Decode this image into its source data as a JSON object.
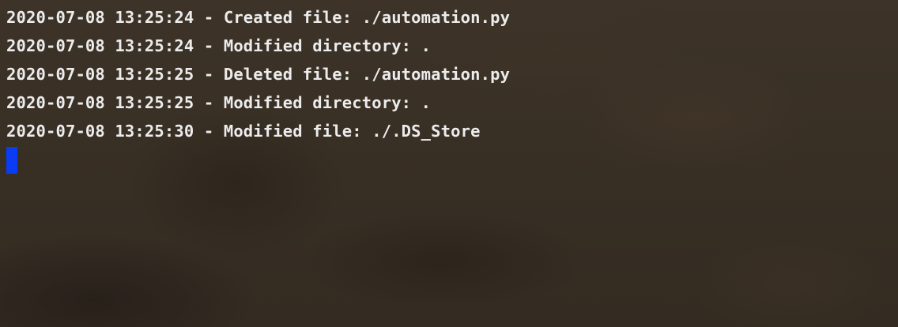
{
  "terminal": {
    "lines": [
      "2020-07-08 13:25:24 - Created file: ./automation.py",
      "2020-07-08 13:25:24 - Modified directory: .",
      "2020-07-08 13:25:25 - Deleted file: ./automation.py",
      "2020-07-08 13:25:25 - Modified directory: .",
      "2020-07-08 13:25:30 - Modified file: ./.DS_Store"
    ],
    "cursor_color": "#0a3cf5",
    "text_color": "#ececec",
    "background_color": "#3a3127"
  }
}
